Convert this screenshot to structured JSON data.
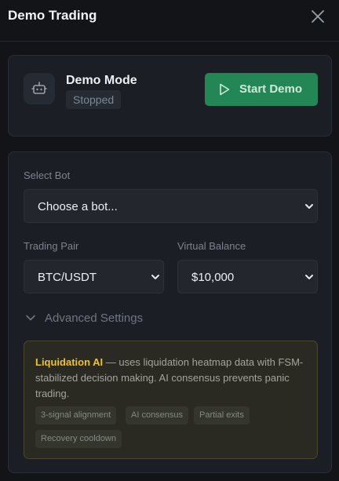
{
  "header": {
    "title": "Demo Trading",
    "close_icon": "close-icon"
  },
  "mode": {
    "icon": "robot-icon",
    "title": "Demo Mode",
    "status": "Stopped",
    "start_icon": "play-icon",
    "start_label": "Start Demo",
    "start_color": "#238755"
  },
  "form": {
    "bot": {
      "label": "Select Bot",
      "value": "Choose a bot..."
    },
    "pair": {
      "label": "Trading Pair",
      "value": "BTC/USDT"
    },
    "balance": {
      "label": "Virtual Balance",
      "value": "$10,000"
    },
    "advanced_label": "Advanced Settings"
  },
  "info": {
    "title": "Liquidation AI",
    "description": " — uses liquidation heatmap data with FSM-stabilized decision making. AI consensus prevents panic trading.",
    "accent_color": "#f0c419",
    "tags": [
      "3-signal alignment",
      "AI consensus",
      "Partial exits",
      "Recovery cooldown"
    ]
  }
}
